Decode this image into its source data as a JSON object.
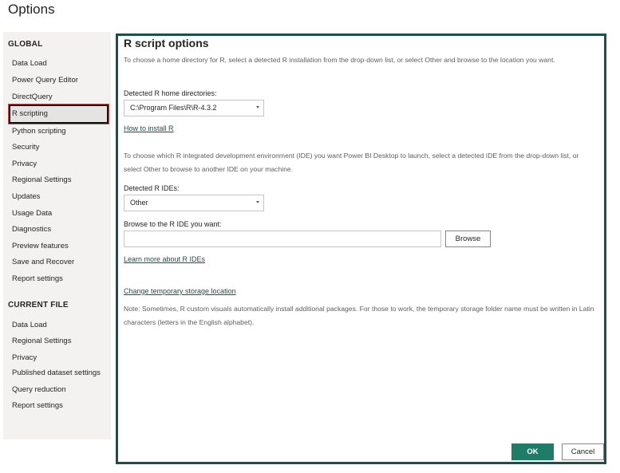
{
  "window": {
    "title": "Options"
  },
  "sidebar": {
    "global_heading": "GLOBAL",
    "global_items": [
      {
        "label": "Data Load"
      },
      {
        "label": "Power Query Editor"
      },
      {
        "label": "DirectQuery"
      },
      {
        "label": "R scripting",
        "selected": true
      },
      {
        "label": "Python scripting"
      },
      {
        "label": "Security"
      },
      {
        "label": "Privacy"
      },
      {
        "label": "Regional Settings"
      },
      {
        "label": "Updates"
      },
      {
        "label": "Usage Data"
      },
      {
        "label": "Diagnostics"
      },
      {
        "label": "Preview features"
      },
      {
        "label": "Save and Recover"
      },
      {
        "label": "Report settings"
      }
    ],
    "current_heading": "CURRENT FILE",
    "current_items": [
      {
        "label": "Data Load"
      },
      {
        "label": "Regional Settings"
      },
      {
        "label": "Privacy"
      },
      {
        "label": "Published dataset settings"
      },
      {
        "label": "Query reduction"
      },
      {
        "label": "Report settings"
      }
    ]
  },
  "main": {
    "title": "R script options",
    "home_dir_description": "To choose a home directory for R, select a detected R installation from the drop-down list, or select Other and browse to the location you want.",
    "home_dirs_label": "Detected R home directories:",
    "home_dir_value": "C:\\Program Files\\R\\R-4.3.2",
    "install_link": "How to install R",
    "ide_description": "To choose which R integrated development environment (IDE) you want Power BI Desktop to launch, select a detected IDE from the drop-down list, or select Other to browse to another IDE on your machine.",
    "ides_label": "Detected R IDEs:",
    "ide_value": "Other",
    "browse_label": "Browse to the R IDE you want:",
    "browse_input_value": "",
    "browse_button": "Browse",
    "learn_link": "Learn more about R IDEs",
    "storage_link": "Change temporary storage location",
    "note": "Note: Sometimes, R custom visuals automatically install additional packages. For those to work, the temporary storage folder name must be written in Latin characters (letters in the English alphabet)."
  },
  "footer": {
    "ok_label": "OK",
    "cancel_label": "Cancel"
  },
  "colors": {
    "accent": "#1f7c69",
    "panel_border": "#1b4f4a",
    "sidebar_bg": "#f3f2f1"
  }
}
